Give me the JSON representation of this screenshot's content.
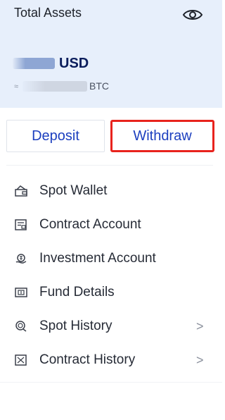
{
  "assets": {
    "title": "Total Assets",
    "visibility_icon": "eye-icon",
    "currency": "USD",
    "approx_symbol": "≈",
    "btc_unit": "BTC"
  },
  "actions": {
    "deposit_label": "Deposit",
    "withdraw_label": "Withdraw",
    "highlight_color": "#e8231d",
    "accent_color": "#1c3fbf"
  },
  "menu": {
    "items": [
      {
        "label": "Spot Wallet",
        "icon": "wallet-icon"
      },
      {
        "label": "Contract Account",
        "icon": "contract-account-icon"
      },
      {
        "label": "Investment Account",
        "icon": "investment-icon"
      },
      {
        "label": "Fund Details",
        "icon": "fund-details-icon"
      },
      {
        "label": "Spot History",
        "icon": "spot-history-icon",
        "chevron": ">"
      },
      {
        "label": "Contract History",
        "icon": "contract-history-icon",
        "chevron": ">"
      }
    ]
  },
  "theme": {
    "header_bg": "#e7effb"
  }
}
